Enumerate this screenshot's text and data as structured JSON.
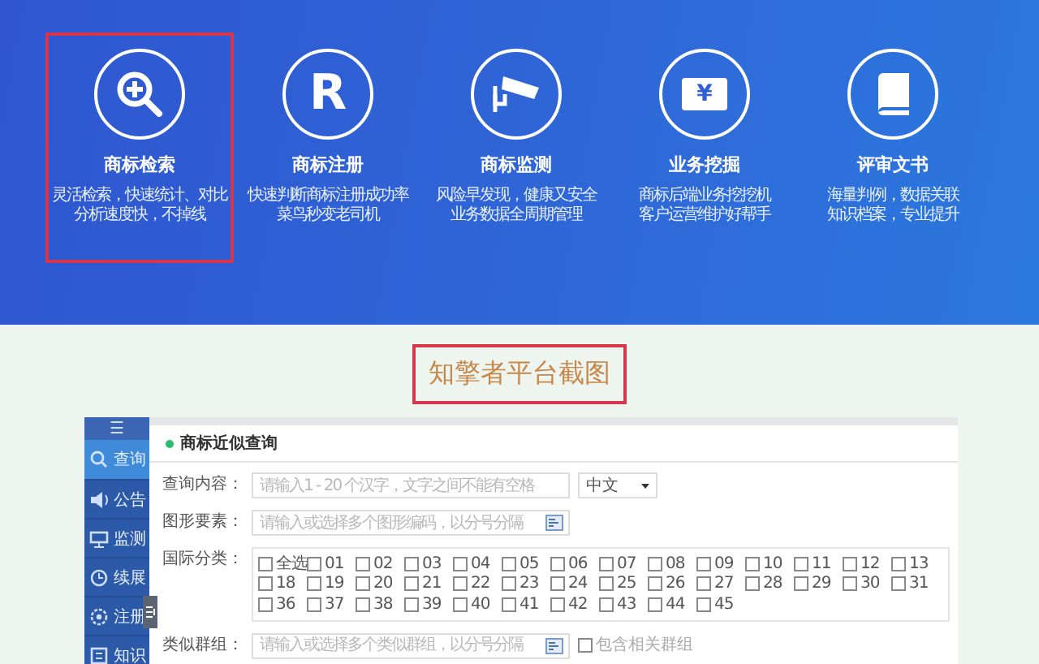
{
  "features": [
    {
      "kind": "search",
      "title": "商标检索",
      "highlighted": true,
      "lines": [
        "灵活检索，快速统计、对比",
        "分析速度快，不掉线"
      ]
    },
    {
      "kind": "letter",
      "glyph": "R",
      "title": "商标注册",
      "highlighted": false,
      "lines": [
        "快速判断商标注册成功率",
        "菜鸟秒变老司机"
      ]
    },
    {
      "kind": "camera",
      "title": "商标监测",
      "highlighted": false,
      "lines": [
        "风险早发现，健康又安全",
        "业务数据全周期管理"
      ]
    },
    {
      "kind": "ticket",
      "glyph": "¥",
      "title": "业务挖掘",
      "highlighted": false,
      "lines": [
        "商标后端业务挖挖机",
        "客户运营维护好帮手"
      ]
    },
    {
      "kind": "book",
      "title": "评审文书",
      "highlighted": false,
      "lines": [
        "海量判例，数据关联",
        "知识档案，专业提升"
      ]
    }
  ],
  "caption": "知擎者平台截图",
  "app": {
    "menu_glyph": "☰",
    "sidebar": [
      {
        "kind": "search",
        "label": "查询",
        "selected": true
      },
      {
        "kind": "speaker",
        "label": "公告",
        "selected": false
      },
      {
        "kind": "monitor",
        "label": "监测",
        "selected": false
      },
      {
        "kind": "clock",
        "label": "续展",
        "selected": false
      },
      {
        "kind": "gear",
        "label": "注册",
        "selected": false
      },
      {
        "kind": "book",
        "label": "知识",
        "selected": false
      }
    ],
    "panel_title": "商标近似查询",
    "form": [
      {
        "kind": "text",
        "label": "查询内容：",
        "placeholder": "请输入1 - 20 个汉字，文字之间不能有空格",
        "select": "中文"
      },
      {
        "kind": "picker",
        "label": "图形要素：",
        "placeholder": "请输入或选择多个图形编码，以分号分隔"
      },
      {
        "kind": "checks",
        "label": "国际分类：",
        "rows": [
          [
            {
              "label": "全选",
              "checked": false
            },
            {
              "label": "01",
              "checked": false
            },
            {
              "label": "02",
              "checked": false
            },
            {
              "label": "03",
              "checked": false
            },
            {
              "label": "04",
              "checked": false
            },
            {
              "label": "05",
              "checked": false
            },
            {
              "label": "06",
              "checked": false
            },
            {
              "label": "07",
              "checked": false
            },
            {
              "label": "08",
              "checked": false
            },
            {
              "label": "09",
              "checked": false
            },
            {
              "label": "10",
              "checked": false
            },
            {
              "label": "11",
              "checked": false
            },
            {
              "label": "12",
              "checked": false
            },
            {
              "label": "13",
              "checked": false
            }
          ],
          [
            {
              "label": "18",
              "checked": false
            },
            {
              "label": "19",
              "checked": false
            },
            {
              "label": "20",
              "checked": false
            },
            {
              "label": "21",
              "checked": false
            },
            {
              "label": "22",
              "checked": false
            },
            {
              "label": "23",
              "checked": false
            },
            {
              "label": "24",
              "checked": false
            },
            {
              "label": "25",
              "checked": false
            },
            {
              "label": "26",
              "checked": false
            },
            {
              "label": "27",
              "checked": false
            },
            {
              "label": "28",
              "checked": false
            },
            {
              "label": "29",
              "checked": false
            },
            {
              "label": "30",
              "checked": false
            },
            {
              "label": "31",
              "checked": false
            }
          ],
          [
            {
              "label": "36",
              "checked": false
            },
            {
              "label": "37",
              "checked": false
            },
            {
              "label": "38",
              "checked": false
            },
            {
              "label": "39",
              "checked": false
            },
            {
              "label": "40",
              "checked": false
            },
            {
              "label": "41",
              "checked": false
            },
            {
              "label": "42",
              "checked": false
            },
            {
              "label": "43",
              "checked": false
            },
            {
              "label": "44",
              "checked": false
            },
            {
              "label": "45",
              "checked": false
            }
          ]
        ]
      },
      {
        "kind": "picker",
        "label": "类似群组：",
        "placeholder": "请输入或选择多个类似群组，以分号分隔",
        "option": "包含相关群组"
      }
    ]
  }
}
